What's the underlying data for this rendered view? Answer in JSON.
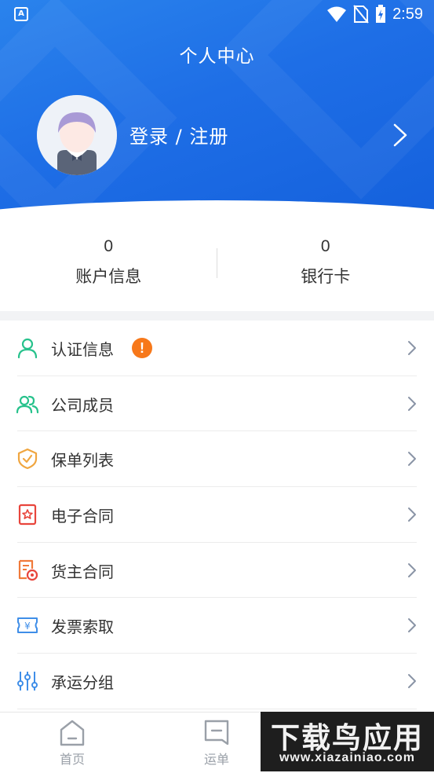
{
  "status_bar": {
    "time": "2:59",
    "app_badge": "A"
  },
  "header": {
    "title": "个人中心",
    "login_text": "登录 / 注册"
  },
  "stats": [
    {
      "value": "0",
      "label": "账户信息"
    },
    {
      "value": "0",
      "label": "银行卡"
    }
  ],
  "menu": [
    {
      "label": "认证信息",
      "icon": "user-icon",
      "badge": "!"
    },
    {
      "label": "公司成员",
      "icon": "users-icon"
    },
    {
      "label": "保单列表",
      "icon": "shield-check-icon"
    },
    {
      "label": "电子合同",
      "icon": "contract-star-icon"
    },
    {
      "label": "货主合同",
      "icon": "document-seal-icon"
    },
    {
      "label": "发票索取",
      "icon": "invoice-icon"
    },
    {
      "label": "承运分组",
      "icon": "sliders-icon"
    }
  ],
  "bottom_nav": [
    {
      "label": "首页",
      "icon": "home-icon"
    },
    {
      "label": "运单",
      "icon": "waybill-icon"
    }
  ],
  "watermark": {
    "top": "下载鸟应用",
    "bottom": "www.xiazainiao.com"
  },
  "colors": {
    "primary": "#1e6ee6",
    "green": "#27c28c",
    "orange": "#f7781a",
    "red": "#e8453c",
    "blue_icon": "#3f8ee8"
  }
}
